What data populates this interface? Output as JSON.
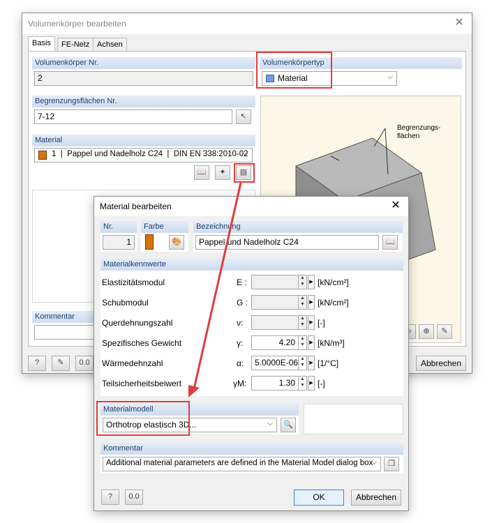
{
  "main": {
    "title": "Volumenkörper bearbeiten",
    "tabs": [
      {
        "label": "Basis"
      },
      {
        "label": "FE-Netz"
      },
      {
        "label": "Achsen"
      }
    ],
    "solid_no_label": "Volumenkörper Nr.",
    "solid_no_value": "2",
    "solid_type_label": "Volumenkörpertyp",
    "solid_type_value": "Material",
    "boundary_label": "Begrenzungsflächen Nr.",
    "boundary_value": "7-12",
    "material_label": "Material",
    "material_value": "1  |  Pappel und Nadelholz C24  |  DIN EN 338:2010-02",
    "comment_label": "Kommentar",
    "comment_value": "",
    "preview_annotation": "Begrenzungs-\nflächen",
    "cancel_button": "Abbrechen"
  },
  "dialog": {
    "title": "Material bearbeiten",
    "nr_label": "Nr.",
    "nr_value": "1",
    "color_label": "Farbe",
    "name_label": "Bezeichnung",
    "name_value": "Pappel und Nadelholz C24",
    "props_header": "Materialkennwerte",
    "properties": [
      {
        "label": "Elastizitätsmodul",
        "symbol": "E :",
        "value": "",
        "unit": "[kN/cm²]"
      },
      {
        "label": "Schubmodul",
        "symbol": "G :",
        "value": "",
        "unit": "[kN/cm²]"
      },
      {
        "label": "Querdehnungszahl",
        "symbol": "ν:",
        "value": "",
        "unit": "[-]"
      },
      {
        "label": "Spezifisches Gewicht",
        "symbol": "γ:",
        "value": "4.20",
        "unit": "[kN/m³]"
      },
      {
        "label": "Wärmedehnzahl",
        "symbol": "α:",
        "value": "5.0000E-06",
        "unit": "[1/°C]"
      },
      {
        "label": "Teilsicherheitsbeiwert",
        "symbol": "γM:",
        "value": "1.30",
        "unit": "[-]"
      }
    ],
    "model_label": "Materialmodell",
    "model_value": "Orthotrop elastisch 3D...",
    "comment_label": "Kommentar",
    "comment_value": "Additional material parameters are defined in the Material Model dialog box",
    "ok_button": "OK",
    "cancel_button": "Abbrechen"
  },
  "colors": {
    "material_swatch": "#d9730d",
    "solid_type_swatch": "#6f9bea",
    "highlight": "#e03c3c",
    "group_header": "#d6e2f1"
  }
}
